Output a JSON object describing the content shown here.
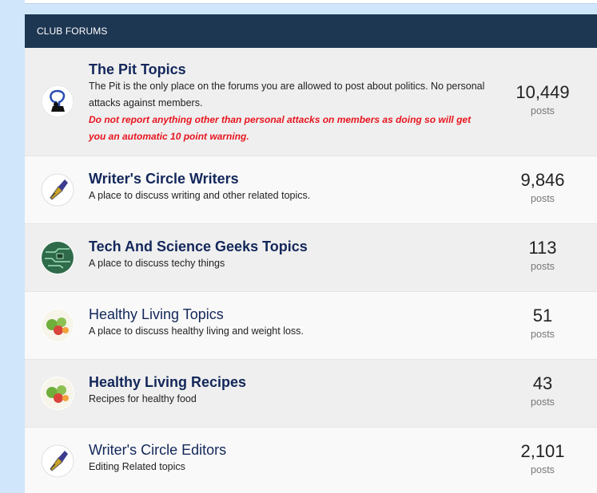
{
  "panel": {
    "title": "CLUB FORUMS"
  },
  "forums": [
    {
      "title": "The Pit Topics",
      "description": "The Pit is the only place on the forums you are allowed to post about politics. No personal attacks against members.",
      "warning": "Do not report anything other than personal attacks on members as doing so will get you an automatic 10 point warning.",
      "count": "10,449",
      "count_label": "posts",
      "icon": "protest-sign-icon",
      "title_bold": true
    },
    {
      "title": "Writer's Circle Writers",
      "description": "A place to discuss writing and other related topics.",
      "count": "9,846",
      "count_label": "posts",
      "icon": "fountain-pen-icon",
      "title_bold": true
    },
    {
      "title": "Tech And Science Geeks Topics",
      "description": "A place to discuss techy things",
      "count": "113",
      "count_label": "posts",
      "icon": "circuit-board-icon",
      "title_bold": true
    },
    {
      "title": "Healthy Living Topics",
      "description": "A place to discuss healthy living and weight loss.",
      "count": "51",
      "count_label": "posts",
      "icon": "vegetables-icon",
      "title_bold": false
    },
    {
      "title": "Healthy Living Recipes",
      "description": "Recipes for healthy food",
      "count": "43",
      "count_label": "posts",
      "icon": "vegetables-icon",
      "title_bold": true
    },
    {
      "title": "Writer's Circle Editors",
      "description": "Editing Related topics",
      "count": "2,101",
      "count_label": "posts",
      "icon": "fountain-pen-icon",
      "title_bold": false
    }
  ]
}
